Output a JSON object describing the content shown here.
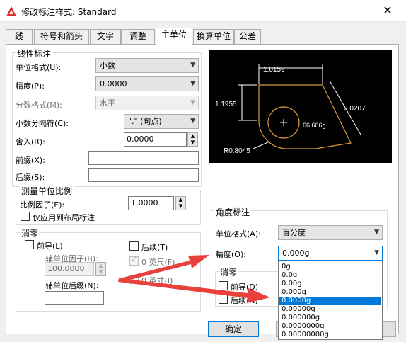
{
  "window": {
    "title": "修改标注样式: Standard",
    "close_glyph": "✕"
  },
  "tabs": [
    {
      "label": "线"
    },
    {
      "label": "符号和箭头"
    },
    {
      "label": "文字"
    },
    {
      "label": "调整"
    },
    {
      "label": "主单位"
    },
    {
      "label": "换算单位"
    },
    {
      "label": "公差"
    }
  ],
  "linear": {
    "group_title": "线性标注",
    "unit_format_label": "单位格式(U):",
    "unit_format_value": "小数",
    "precision_label": "精度(P):",
    "precision_value": "0.0000",
    "fraction_label": "分数格式(M):",
    "fraction_value": "水平",
    "decimal_sep_label": "小数分隔符(C):",
    "decimal_sep_value": "\".\" (句点)",
    "roundoff_label": "舍入(R):",
    "roundoff_value": "0.0000",
    "prefix_label": "前缀(X):",
    "prefix_value": "",
    "suffix_label": "后缀(S):",
    "suffix_value": ""
  },
  "scale": {
    "group_title": "测量单位比例",
    "factor_label": "比例因子(E):",
    "factor_value": "1.0000",
    "layout_only_label": "仅应用到布局标注"
  },
  "zero_suppress": {
    "group_title": "消零",
    "leading_label": "前导(L)",
    "sub_factor_label": "辅单位因子(B):",
    "sub_factor_value": "100.0000",
    "sub_suffix_label": "辅单位后缀(N):",
    "sub_suffix_value": "",
    "trailing_label": "后续(T)",
    "feet_label": "0 英尺(F)",
    "inches_label": "0 英寸(I)"
  },
  "preview": {
    "dim_top": "1.0159",
    "dim_left": "1.1955",
    "dim_right": "2.0207",
    "dim_angle": "66.666g",
    "dim_radius": "R0.8045"
  },
  "angular": {
    "group_title": "角度标注",
    "unit_format_label": "单位格式(A):",
    "unit_format_value": "百分度",
    "precision_label": "精度(O):",
    "precision_value": "0.000g"
  },
  "angular_zero": {
    "group_title": "消零",
    "leading_label": "前导(D)",
    "trailing_label": "后续(N)"
  },
  "precision_dropdown": {
    "options": [
      "0g",
      "0.0g",
      "0.00g",
      "0.000g",
      "0.0000g",
      "0.00000g",
      "0.000000g",
      "0.0000000g",
      "0.00000000g"
    ],
    "selected_index": 4
  },
  "buttons": {
    "ok_label": "确定"
  },
  "colors": {
    "arrow": "#e8413b",
    "preview_bg": "#000000",
    "preview_shape": "#d89a3a",
    "selection": "#0078d7"
  }
}
